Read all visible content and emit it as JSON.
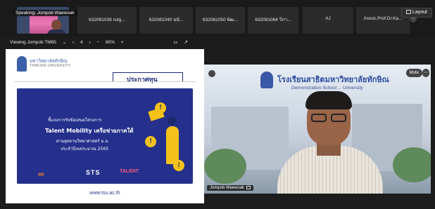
{
  "top_strip": {
    "speaking_label": "Speaking: Jompob Waewsak",
    "participants": [
      {
        "name": "632081039 เบญ..."
      },
      {
        "name": "632081040 นนั..."
      },
      {
        "name": "632081050 พัฒ..."
      },
      {
        "name": "632081064 วิภา..."
      },
      {
        "name": "AJ"
      },
      {
        "name": "Assoc.Prof.Dr.Ka..."
      }
    ],
    "layout_label": "Layout"
  },
  "viewing_bar": {
    "viewing_label": "Viewing Jompob TM65",
    "page_number": "4",
    "zoom_label": "80%",
    "zoom_out": "−",
    "zoom_in": "+"
  },
  "shared_slide": {
    "university_name_th": "มหาวิทยาลัยทักษิณ",
    "university_name_en": "THAKSIN UNIVERSITY",
    "header_title": "ประกาศทุน",
    "line1": "ชี้แจงการรับข้อเสนอโครงการ",
    "line2": "Talent Mobility เครือข่ายภาคใต้",
    "line3": "ผ่านอุทยานวิทยาศาสตร์ ม.อ.",
    "line4": "ประจำปีงบประมาณ 2565",
    "logo_a": "∞",
    "logo_b": "STS",
    "logo_c": "TALENT",
    "footer_url": "www.tsu.ac.th"
  },
  "speaker_video": {
    "school_name_th": "โรงเรียนสาธิตมหาวิทยาลัยทักษิณ",
    "school_name_en": "Demonstration School ... University",
    "mute_label": "Mute",
    "speaker_name": "Jompob Waewsak"
  },
  "colors": {
    "slide_blue": "#24308c",
    "accent_yellow": "#f4c21b"
  }
}
